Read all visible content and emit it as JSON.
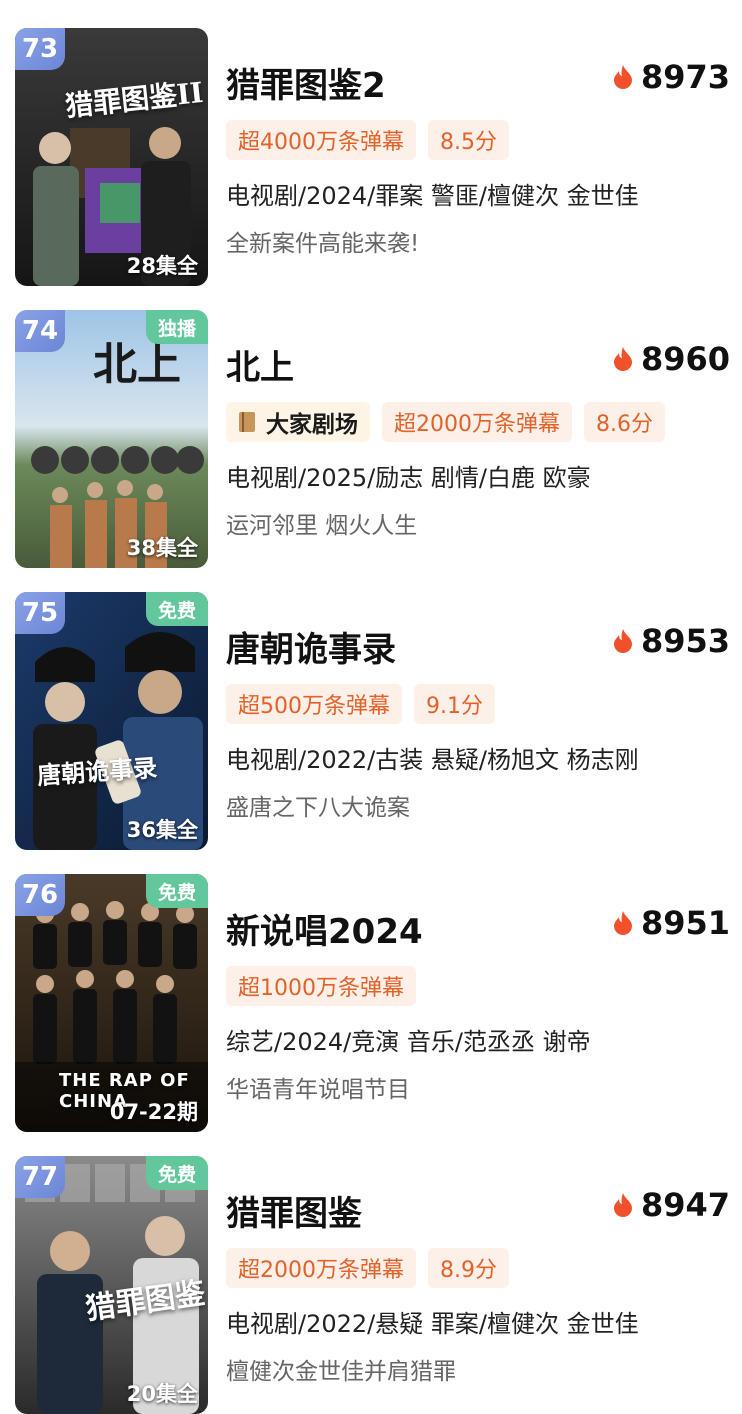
{
  "items": [
    {
      "rank": "73",
      "badge": "",
      "episodes": "28集全",
      "poster_title": "猎罪图鉴II",
      "title": "猎罪图鉴2",
      "heat": "8973",
      "theater": "",
      "danmaku": "超4000万条弹幕",
      "score": "8.5分",
      "meta": "电视剧/2024/罪案 警匪/檀健次 金世佳",
      "desc": "全新案件高能来袭!"
    },
    {
      "rank": "74",
      "badge": "独播",
      "episodes": "38集全",
      "poster_title": "北上",
      "title": "北上",
      "heat": "8960",
      "theater": "大家剧场",
      "danmaku": "超2000万条弹幕",
      "score": "8.6分",
      "meta": "电视剧/2025/励志 剧情/白鹿 欧豪",
      "desc": "运河邻里 烟火人生"
    },
    {
      "rank": "75",
      "badge": "免费",
      "episodes": "36集全",
      "poster_title": "唐朝诡事录",
      "title": "唐朝诡事录",
      "heat": "8953",
      "theater": "",
      "danmaku": "超500万条弹幕",
      "score": "9.1分",
      "meta": "电视剧/2022/古装 悬疑/杨旭文 杨志刚",
      "desc": "盛唐之下八大诡案"
    },
    {
      "rank": "76",
      "badge": "免费",
      "episodes": "07-22期",
      "poster_title": "THE RAP OF CHINA",
      "title": "新说唱2024",
      "heat": "8951",
      "theater": "",
      "danmaku": "超1000万条弹幕",
      "score": "",
      "meta": "综艺/2024/竞演 音乐/范丞丞 谢帝",
      "desc": "华语青年说唱节目"
    },
    {
      "rank": "77",
      "badge": "免费",
      "episodes": "20集全",
      "poster_title": "猎罪图鉴",
      "title": "猎罪图鉴",
      "heat": "8947",
      "theater": "",
      "danmaku": "超2000万条弹幕",
      "score": "8.9分",
      "meta": "电视剧/2022/悬疑 罪案/檀健次 金世佳",
      "desc": "檀健次金世佳并肩猎罪"
    }
  ],
  "colors": {
    "rank_badge": "#7a93df",
    "corner_badge": "#62c79a",
    "tag_text": "#e2622a",
    "tag_bg": "#fdf0e8",
    "flame": "#f0502a"
  },
  "icons": {
    "heat": "flame-icon",
    "theater": "book-icon"
  }
}
